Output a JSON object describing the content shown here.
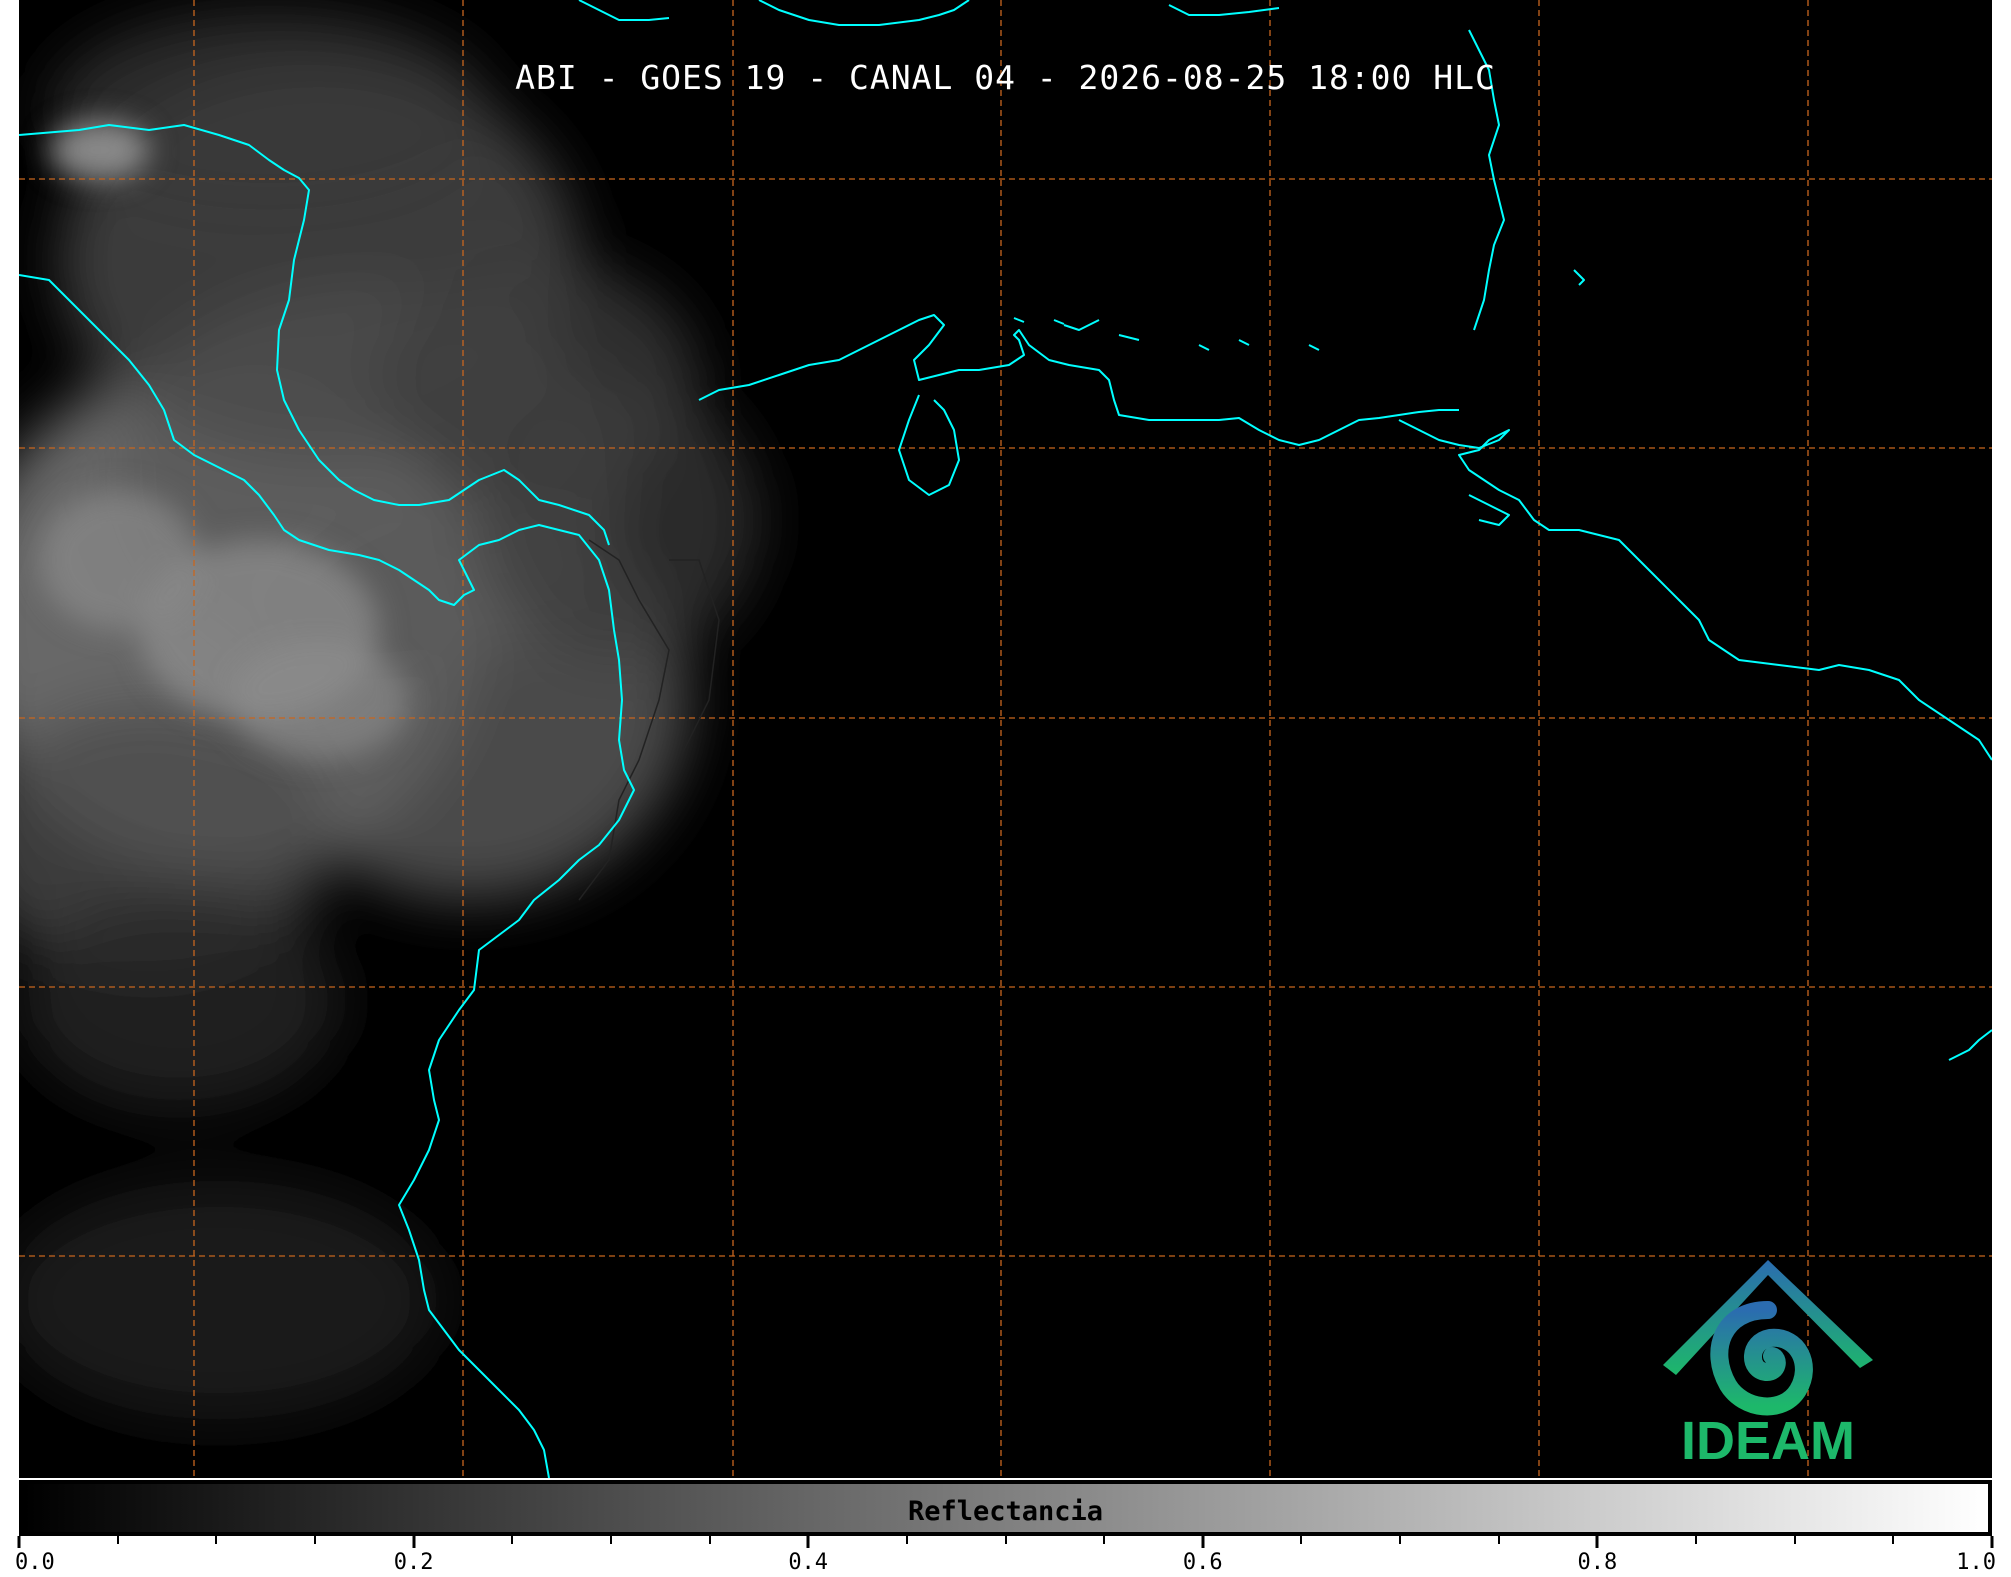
{
  "map": {
    "title": "ABI - GOES 19 - CANAL 04 - 2026-08-25 18:00 HLC",
    "background_color": "#000000",
    "coastline_color": "#00ffff",
    "graticule_color": "#c8661e",
    "border_color": "#222222"
  },
  "colorbar": {
    "label": "Reflectancia",
    "gradient_start": "#000000",
    "gradient_end": "#ffffff",
    "tick_labels": [
      "0.0",
      "0.2",
      "0.4",
      "0.6",
      "0.8",
      "1.0"
    ],
    "minor_ticks_per_interval": 4
  },
  "logo": {
    "text": "IDEAM",
    "icon": "ideam-mountain-spiral-icon",
    "color_top": "#2b6cb0",
    "color_bottom": "#1db86a"
  }
}
